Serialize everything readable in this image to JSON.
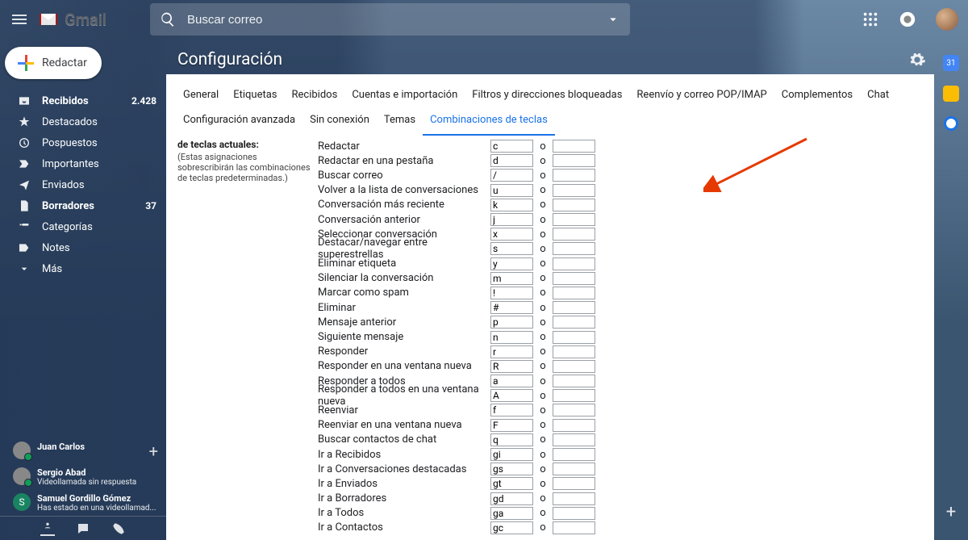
{
  "brand": "Gmail",
  "search": {
    "placeholder": "Buscar correo"
  },
  "compose_label": "Redactar",
  "nav": {
    "inbox": {
      "label": "Recibidos",
      "count": "2.428"
    },
    "starred": {
      "label": "Destacados"
    },
    "snoozed": {
      "label": "Pospuestos"
    },
    "important": {
      "label": "Importantes"
    },
    "sent": {
      "label": "Enviados"
    },
    "drafts": {
      "label": "Borradores",
      "count": "37"
    },
    "categories": {
      "label": "Categorías"
    },
    "notes": {
      "label": "Notes"
    },
    "more": {
      "label": "Más"
    }
  },
  "title": "Configuración",
  "tabs": {
    "r1": [
      "General",
      "Etiquetas",
      "Recibidos",
      "Cuentas e importación",
      "Filtros y direcciones bloqueadas",
      "Reenvío y correo POP/IMAP",
      "Complementos",
      "Chat"
    ],
    "r2": [
      "Configuración avanzada",
      "Sin conexión",
      "Temas",
      "Combinaciones de teclas"
    ],
    "active": "Combinaciones de teclas"
  },
  "section": {
    "title": "de teclas actuales:",
    "note": "(Estas asignaciones sobrescribirán las combinaciones de teclas predeterminadas.)"
  },
  "or_label": "o",
  "shortcuts": [
    {
      "action": "Redactar",
      "k": "c"
    },
    {
      "action": "Redactar en una pestaña",
      "k": "d"
    },
    {
      "action": "Buscar correo",
      "k": "/"
    },
    {
      "action": "Volver a la lista de conversaciones",
      "k": "u"
    },
    {
      "action": "Conversación más reciente",
      "k": "k"
    },
    {
      "action": "Conversación anterior",
      "k": "j"
    },
    {
      "action": "Seleccionar conversación",
      "k": "x"
    },
    {
      "action": "Destacar/navegar entre superestrellas",
      "k": "s"
    },
    {
      "action": "Eliminar etiqueta",
      "k": "y"
    },
    {
      "action": "Silenciar la conversación",
      "k": "m"
    },
    {
      "action": "Marcar como spam",
      "k": "!"
    },
    {
      "action": "Eliminar",
      "k": "#"
    },
    {
      "action": "Mensaje anterior",
      "k": "p"
    },
    {
      "action": "Siguiente mensaje",
      "k": "n"
    },
    {
      "action": "Responder",
      "k": "r"
    },
    {
      "action": "Responder en una ventana nueva",
      "k": "R"
    },
    {
      "action": "Responder a todos",
      "k": "a"
    },
    {
      "action": "Responder a todos en una ventana nueva",
      "k": "A"
    },
    {
      "action": "Reenviar",
      "k": "f"
    },
    {
      "action": "Reenviar en una ventana nueva",
      "k": "F"
    },
    {
      "action": "Buscar contactos de chat",
      "k": "q"
    },
    {
      "action": "Ir a Recibidos",
      "k": "gi"
    },
    {
      "action": "Ir a Conversaciones destacadas",
      "k": "gs"
    },
    {
      "action": "Ir a Enviados",
      "k": "gt"
    },
    {
      "action": "Ir a Borradores",
      "k": "gd"
    },
    {
      "action": "Ir a Todos",
      "k": "ga"
    },
    {
      "action": "Ir a Contactos",
      "k": "gc"
    }
  ],
  "hangouts": [
    {
      "name": "Juan Carlos",
      "sub": "",
      "kind": "green"
    },
    {
      "name": "Sergio Abad",
      "sub": "Videollamada sin respuesta",
      "kind": "green"
    },
    {
      "name": "Samuel Gordillo Gómez",
      "sub": "Has estado en una videollamad...",
      "kind": "initial",
      "initial": "S"
    }
  ],
  "rail_cal": "31"
}
